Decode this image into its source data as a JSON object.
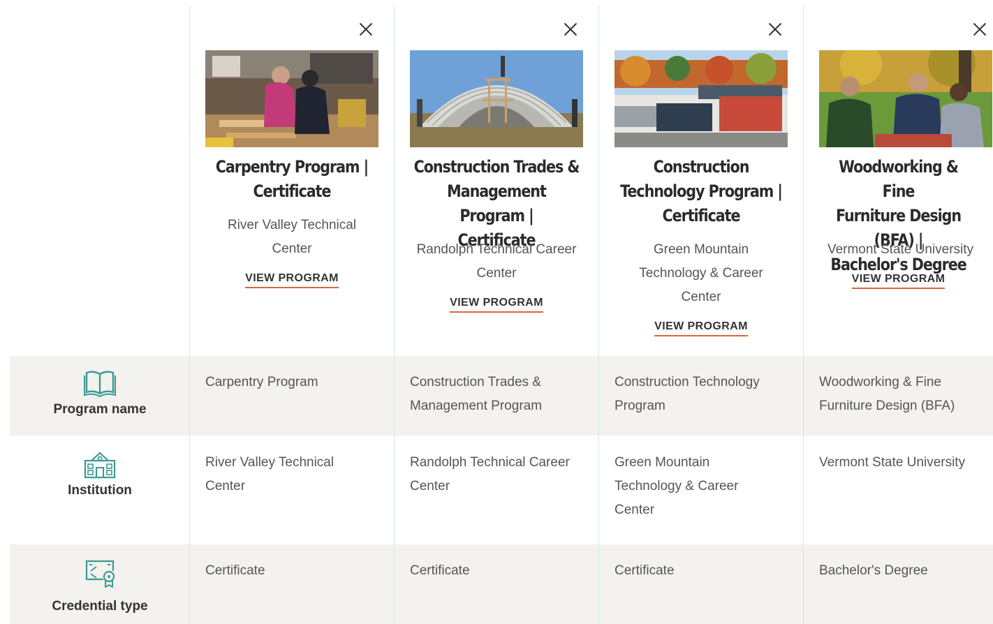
{
  "programs": [
    {
      "title_line1": "Carpentry Program |",
      "title_line2": "Certificate",
      "title_line3": "",
      "institution_line1": "River Valley Technical",
      "institution_line2": "Center",
      "institution_line3": "",
      "link_label": "VIEW PROGRAM",
      "image_icon": "workshop-photo",
      "close_icon": "close-icon"
    },
    {
      "title_line1": "Construction Trades &",
      "title_line2": "Management Program |",
      "title_line3": "Certificate",
      "institution_line1": "Randolph Technical Career",
      "institution_line2": "Center",
      "institution_line3": "",
      "link_label": "VIEW PROGRAM",
      "image_icon": "hoop-house-photo",
      "close_icon": "close-icon"
    },
    {
      "title_line1": "Construction",
      "title_line2": "Technology Program |",
      "title_line3": "Certificate",
      "institution_line1": "Green Mountain",
      "institution_line2": "Technology & Career",
      "institution_line3": "Center",
      "link_label": "VIEW PROGRAM",
      "image_icon": "campus-building-photo",
      "close_icon": "close-icon"
    },
    {
      "title_line1": "Woodworking & Fine",
      "title_line2": "Furniture Design (BFA) |",
      "title_line3": "Bachelor's Degree",
      "institution_line1": "Vermont State University",
      "institution_line2": "",
      "institution_line3": "",
      "link_label": "VIEW PROGRAM",
      "image_icon": "students-lawn-photo",
      "close_icon": "close-icon"
    }
  ],
  "rows": {
    "program_name": {
      "label": "Program name",
      "icon": "open-book-icon",
      "values": [
        [
          "Carpentry Program",
          ""
        ],
        [
          "Construction Trades &",
          "Management Program"
        ],
        [
          "Construction Technology",
          "Program"
        ],
        [
          "Woodworking & Fine",
          "Furniture Design (BFA)"
        ]
      ]
    },
    "institution": {
      "label": "Institution",
      "icon": "school-building-icon",
      "values": [
        [
          "River Valley Technical",
          "Center",
          ""
        ],
        [
          "Randolph Technical Career",
          "Center",
          ""
        ],
        [
          "Green Mountain",
          "Technology & Career",
          "Center"
        ],
        [
          "Vermont State University",
          "",
          ""
        ]
      ]
    },
    "credential_type": {
      "label": "Credential type",
      "icon": "certificate-icon",
      "values": [
        "Certificate",
        "Certificate",
        "Certificate",
        "Bachelor's Degree"
      ]
    }
  },
  "colors": {
    "accent_underline": "#d9673f",
    "icon_teal": "#3a9a94",
    "row_shade": "#f3f2ee",
    "divider": "#d6e6e4"
  }
}
